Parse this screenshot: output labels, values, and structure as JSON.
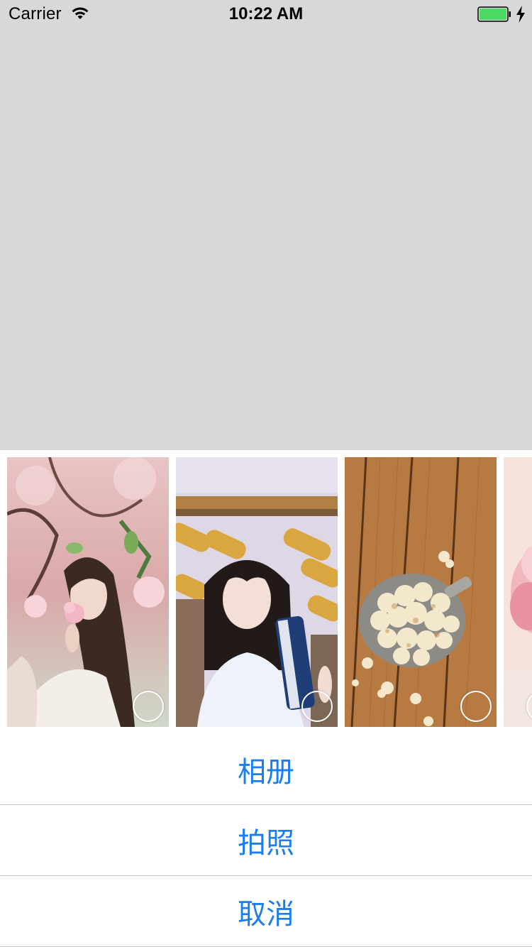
{
  "status_bar": {
    "carrier": "Carrier",
    "time": "10:22 AM",
    "battery_color": "#4cd964"
  },
  "photos": [
    {
      "subject": "girl-with-blossoms"
    },
    {
      "subject": "girl-with-book"
    },
    {
      "subject": "popcorn-on-wood"
    },
    {
      "subject": "pink-flower-partial"
    }
  ],
  "actions": {
    "album": "相册",
    "camera": "拍照",
    "cancel": "取消"
  },
  "colors": {
    "action_text": "#1a7ef2",
    "background": "#d8d8d8"
  }
}
